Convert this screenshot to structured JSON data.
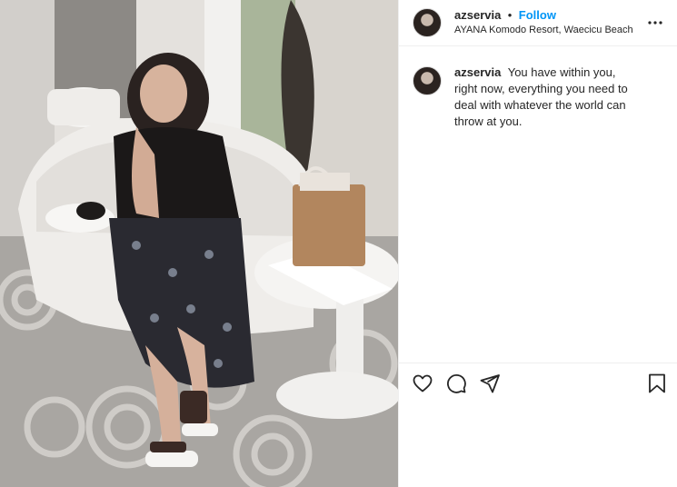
{
  "post": {
    "username": "azservia",
    "separator": "•",
    "follow_label": "Follow",
    "location": "AYANA Komodo Resort, Waecicu Beach",
    "caption": "You have within you, right now, everything you need to deal with whatever the world can throw at you."
  },
  "icons": {
    "more": "more-options-icon",
    "like": "heart-icon",
    "comment": "comment-icon",
    "share": "paper-plane-icon",
    "save": "bookmark-icon"
  },
  "colors": {
    "follow": "#0095f6",
    "text": "#262626",
    "border": "#efefef"
  }
}
